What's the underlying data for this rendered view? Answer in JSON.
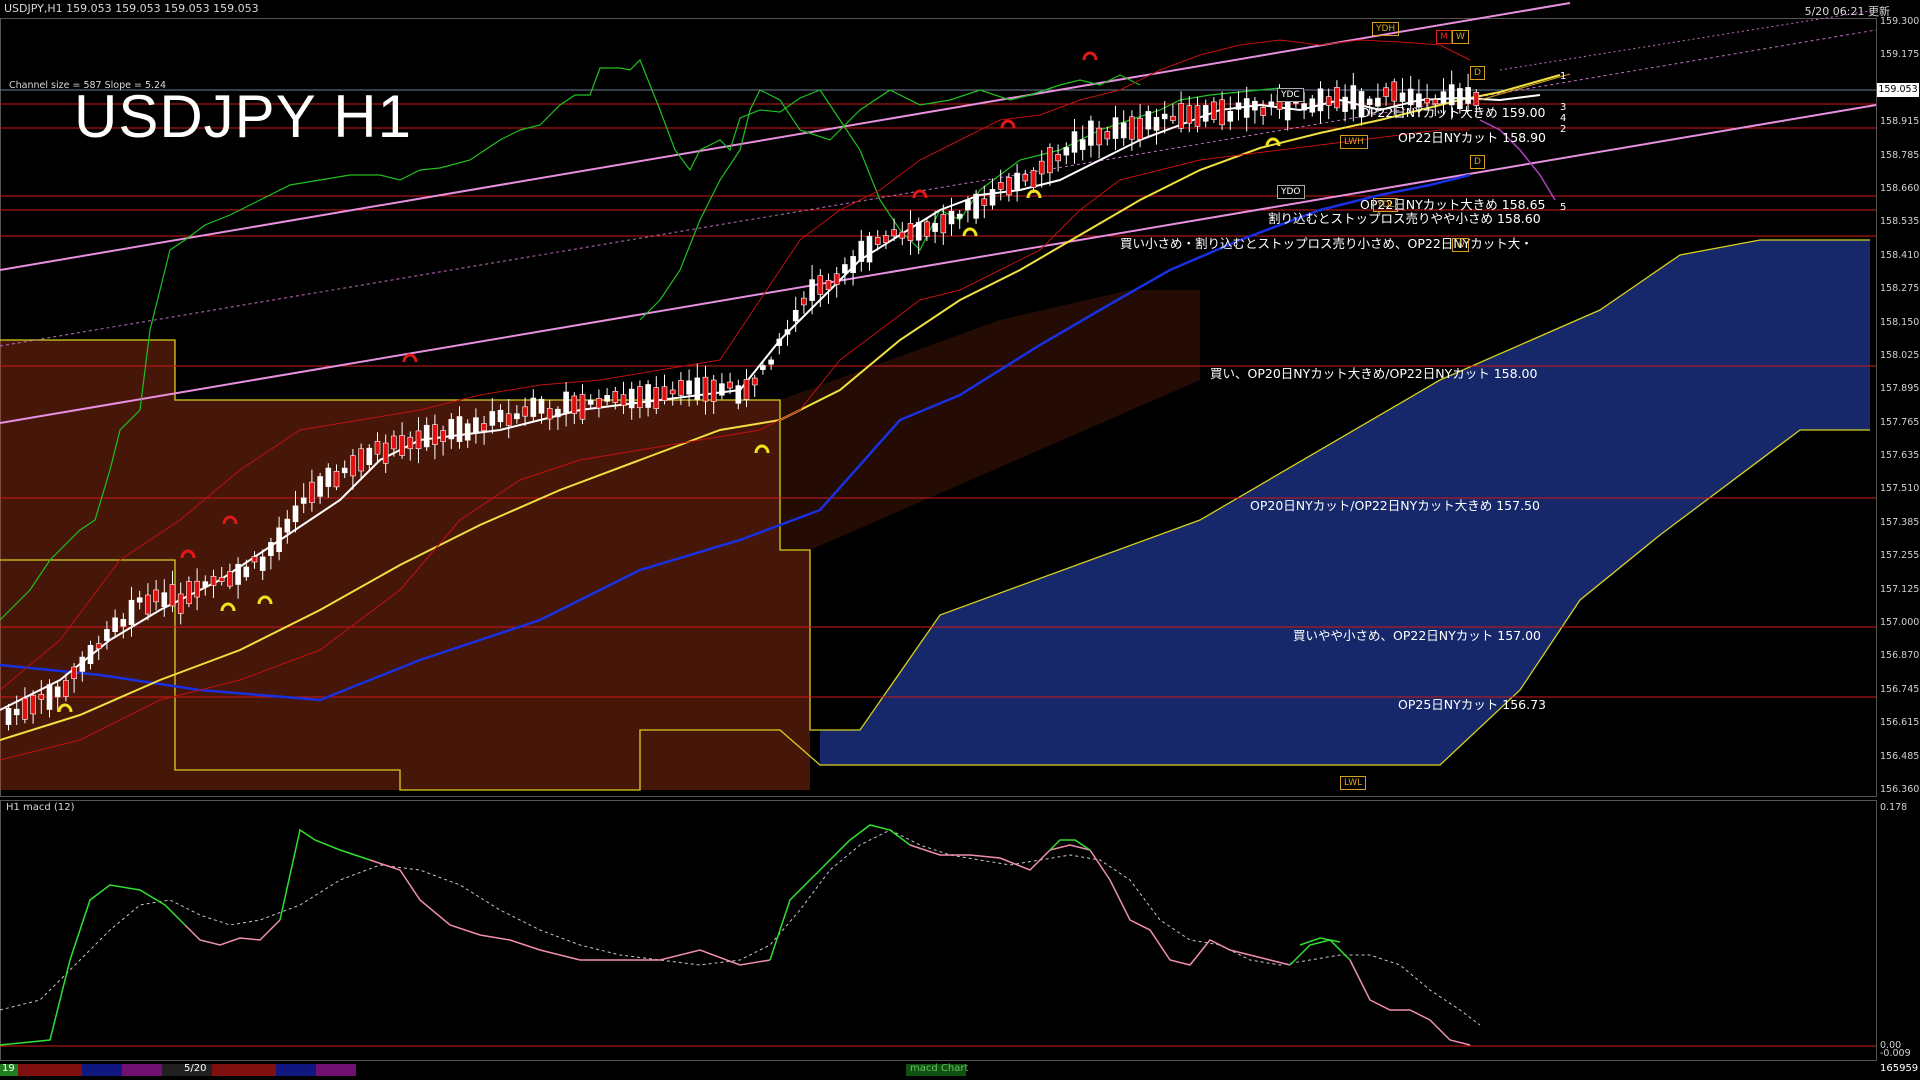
{
  "window": {
    "title": "USDJPY,H1  159.053 159.053 159.053 159.053",
    "clock": "5/20 06:21 更新"
  },
  "chart": {
    "main_title": "USDJPY H1",
    "channel_info": "Channel size = 587 Slope = 5.24",
    "current_price": "159.053",
    "price_axis": [
      "159.300",
      "159.175",
      "159.053",
      "158.915",
      "158.785",
      "158.660",
      "158.535",
      "158.410",
      "158.275",
      "158.150",
      "158.025",
      "157.895",
      "157.765",
      "157.635",
      "157.510",
      "157.385",
      "157.255",
      "157.125",
      "157.000",
      "156.870",
      "156.745",
      "156.615",
      "156.485",
      "156.360"
    ],
    "annotations": [
      {
        "text": "OP22日NYカット大きめ 159.00"
      },
      {
        "text": "OP22日NYカット 158.90"
      },
      {
        "text": "OP22日NYカット大きめ 158.65"
      },
      {
        "text": "割り込むとストップロス売りやや小さめ 158.60"
      },
      {
        "text": "買い小さめ・割り込むとストップロス売り小さめ、OP22日NYカット大・"
      },
      {
        "text": "買い、OP20日NYカット大きめ/OP22日NYカット 158.00"
      },
      {
        "text": "OP20日NYカット/OP22日NYカット大きめ 157.50"
      },
      {
        "text": "買いやや小さめ、OP22日NYカット 157.00"
      },
      {
        "text": "OP25日NYカット 156.73"
      }
    ],
    "level_tags": {
      "ydh": "YDH",
      "ydc": "YDC",
      "ydo": "YDO",
      "ydl": "YDL",
      "lwh": "LWH",
      "lwl": "LWL",
      "m": "M",
      "w": "W",
      "w2": "W",
      "d": "D",
      "d2": "D"
    },
    "channel_numbers": [
      "1",
      "3",
      "4",
      "2",
      "5"
    ]
  },
  "macd": {
    "title": "H1  macd (12)",
    "axis": [
      "0.178",
      "0.00",
      "-0.009"
    ]
  },
  "tabs": {
    "left": "19",
    "mid": "5/20",
    "indicator": "macd Chart",
    "right": "165959"
  },
  "colors": {
    "background": "#000000",
    "red_hline": "#d01818",
    "channel": "#e890e0",
    "tenkan": "#ffffff",
    "kijun": "#f0e040",
    "blue_ma": "#1830e0",
    "kumo_up": "#c84018",
    "kumo_down": "#2848c0",
    "chikou": "#20c020",
    "macd_up": "#30e030",
    "macd_down": "#f090b0"
  }
}
